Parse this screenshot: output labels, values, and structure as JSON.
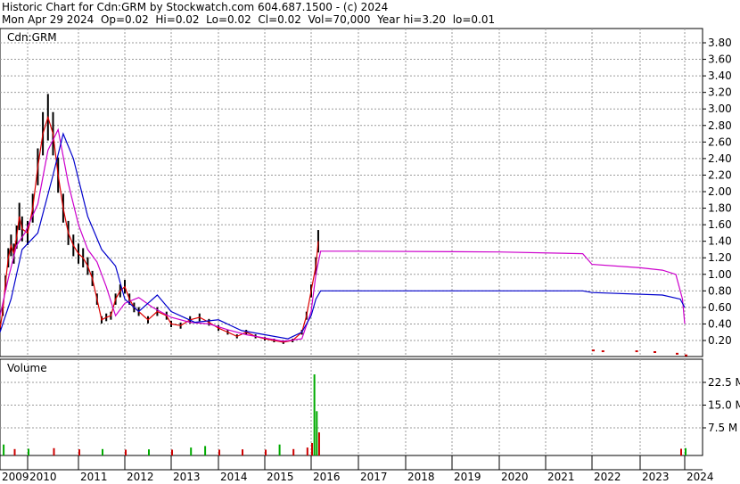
{
  "header": {
    "line1": "Historic Chart for Cdn:GRM by Stockwatch.com 604.687.1500 - (c) 2024",
    "line2": "Mon Apr 29 2024  Op=0.02  Hi=0.02  Lo=0.02  Cl=0.02  Vol=70,000  Year hi=3.20  lo=0.01"
  },
  "chart_data": [
    {
      "type": "line",
      "title": "Cdn:GRM",
      "price_series_style": "OHLC bars (black) with close line (red)",
      "ylim": [
        0,
        3.9
      ],
      "y_ticks": [
        "3.80",
        "3.60",
        "3.40",
        "3.20",
        "3.00",
        "2.80",
        "2.60",
        "2.40",
        "2.20",
        "2.00",
        "1.80",
        "1.60",
        "1.40",
        "1.20",
        "1.00",
        "0.80",
        "0.60",
        "0.40",
        "0.20"
      ],
      "x_ticks": [
        "2009",
        "2010",
        "2011",
        "2012",
        "2013",
        "2014",
        "2015",
        "2016",
        "2017",
        "2018",
        "2019",
        "2020",
        "2021",
        "2022",
        "2023",
        "2024"
      ],
      "grid": true,
      "price": {
        "x": [
          2009.0,
          2009.1,
          2009.2,
          2009.3,
          2009.4,
          2009.5,
          2009.6,
          2009.7,
          2009.8,
          2010.0,
          2010.1,
          2010.2,
          2010.3,
          2010.4,
          2010.5,
          2010.6,
          2010.7,
          2010.8,
          2010.9,
          2011.0,
          2011.1,
          2011.2,
          2011.3,
          2011.4,
          2011.5,
          2011.6,
          2011.7,
          2011.8,
          2011.9,
          2012.0,
          2012.1,
          2012.2,
          2012.3,
          2012.5,
          2012.7,
          2012.9,
          2013.0,
          2013.2,
          2013.4,
          2013.6,
          2013.8,
          2014.0,
          2014.2,
          2014.4,
          2014.6,
          2014.8,
          2015.0,
          2015.2,
          2015.4,
          2015.6,
          2015.8,
          2015.9,
          2016.0,
          2016.1,
          2016.15
        ],
        "y": [
          0.35,
          0.55,
          0.9,
          1.2,
          1.35,
          1.25,
          1.45,
          1.7,
          1.55,
          1.5,
          1.8,
          2.3,
          2.7,
          2.9,
          2.7,
          2.2,
          1.8,
          1.5,
          1.35,
          1.25,
          1.2,
          1.1,
          0.95,
          0.7,
          0.45,
          0.48,
          0.5,
          0.7,
          0.8,
          0.85,
          0.7,
          0.6,
          0.55,
          0.45,
          0.55,
          0.5,
          0.4,
          0.38,
          0.45,
          0.48,
          0.42,
          0.35,
          0.3,
          0.25,
          0.3,
          0.25,
          0.22,
          0.2,
          0.18,
          0.2,
          0.3,
          0.5,
          0.8,
          1.1,
          1.4
        ]
      },
      "moving_average_1": {
        "color": "#cc00cc",
        "x": [
          2009.0,
          2009.3,
          2009.6,
          2009.9,
          2010.2,
          2010.4,
          2010.6,
          2010.8,
          2011.0,
          2011.2,
          2011.4,
          2011.6,
          2011.8,
          2012.0,
          2012.3,
          2012.6,
          2013.0,
          2013.4,
          2013.8,
          2014.2,
          2014.6,
          2015.0,
          2015.4,
          2015.8,
          2016.0,
          2016.1,
          2016.2,
          2017.0,
          2020.0,
          2021.8,
          2022.0,
          2023.0,
          2023.5,
          2023.8,
          2023.95,
          2024.0
        ],
        "y": [
          0.5,
          0.95,
          1.35,
          1.5,
          1.85,
          2.5,
          2.75,
          2.1,
          1.6,
          1.3,
          1.15,
          0.85,
          0.5,
          0.65,
          0.72,
          0.6,
          0.48,
          0.42,
          0.4,
          0.33,
          0.27,
          0.23,
          0.19,
          0.22,
          0.55,
          1.0,
          1.28,
          1.28,
          1.27,
          1.25,
          1.12,
          1.08,
          1.05,
          1.0,
          0.7,
          0.4
        ]
      },
      "moving_average_2": {
        "color": "#0000cc",
        "x": [
          2009.0,
          2009.4,
          2009.8,
          2010.2,
          2010.5,
          2010.7,
          2010.9,
          2011.2,
          2011.5,
          2011.8,
          2012.0,
          2012.3,
          2012.7,
          2013.0,
          2013.5,
          2014.0,
          2014.5,
          2015.0,
          2015.5,
          2015.8,
          2016.0,
          2016.1,
          2016.2,
          2020.0,
          2021.8,
          2022.0,
          2023.5,
          2023.9,
          2024.0
        ],
        "y": [
          0.3,
          0.7,
          1.3,
          1.5,
          2.2,
          2.7,
          2.4,
          1.7,
          1.3,
          1.1,
          0.7,
          0.55,
          0.75,
          0.55,
          0.42,
          0.45,
          0.32,
          0.27,
          0.22,
          0.3,
          0.5,
          0.7,
          0.8,
          0.8,
          0.8,
          0.78,
          0.75,
          0.7,
          0.6
        ]
      },
      "late_trades": {
        "x": [
          2022.0,
          2022.2,
          2022.9,
          2023.3,
          2023.8,
          2024.0
        ],
        "y": [
          0.08,
          0.07,
          0.07,
          0.06,
          0.04,
          0.02
        ]
      }
    },
    {
      "type": "bar",
      "title": "Volume",
      "ylim": [
        0,
        30
      ],
      "y_ticks": [
        "22.5 M",
        "15.0 M",
        "7.5 M"
      ],
      "volume": {
        "x": [
          2009.1,
          2009.5,
          2010.0,
          2010.5,
          2011.0,
          2011.5,
          2012.0,
          2012.5,
          2013.0,
          2013.4,
          2013.7,
          2014.0,
          2014.5,
          2015.0,
          2015.3,
          2015.6,
          2015.9,
          2016.0,
          2016.05,
          2016.1,
          2016.15,
          2023.9,
          2024.0
        ],
        "values": [
          2.0,
          0.5,
          0.6,
          0.8,
          0.4,
          0.5,
          0.3,
          0.4,
          0.3,
          1.0,
          1.5,
          0.3,
          0.4,
          0.3,
          2.0,
          0.5,
          1.0,
          2.5,
          30.0,
          13.0,
          6.0,
          0.6,
          0.8
        ],
        "colors": [
          "#00aa00",
          "#cc0000",
          "#00aa00",
          "#cc0000",
          "#cc0000",
          "#00aa00",
          "#cc0000",
          "#00aa00",
          "#cc0000",
          "#00aa00",
          "#00aa00",
          "#cc0000",
          "#cc0000",
          "#cc0000",
          "#00aa00",
          "#cc0000",
          "#cc0000",
          "#cc0000",
          "#00aa00",
          "#00aa00",
          "#cc0000",
          "#cc0000",
          "#00aa00"
        ]
      }
    }
  ]
}
